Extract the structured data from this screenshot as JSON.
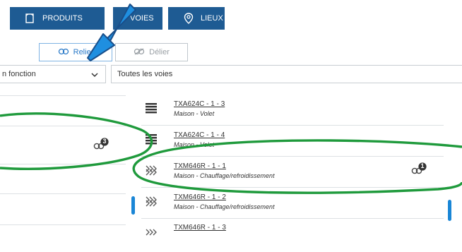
{
  "tabs": [
    {
      "label": "PRODUITS",
      "icon": "box-icon"
    },
    {
      "label": "VOIES",
      "icon": ""
    },
    {
      "label": "LIEUX",
      "icon": "location-pin-icon"
    }
  ],
  "actions": {
    "relier_label": "Relier",
    "delier_label": "Délier"
  },
  "filters": {
    "left_select": "n fonction",
    "right_select": "Toutes les voies"
  },
  "left_list": {
    "badge_count": "3"
  },
  "right_list": [
    {
      "code": "TXA624C - 1 - 3",
      "subtitle": "Maison - Volet",
      "icon": "shutter-icon"
    },
    {
      "code": "TXA624C - 1 - 4",
      "subtitle": "Maison - Volet",
      "icon": "shutter-icon"
    },
    {
      "code": "TXM646R - 1 - 1",
      "subtitle": "Maison - Chauffage/refroidissement",
      "icon": "heating-icon",
      "badge": "1"
    },
    {
      "code": "TXM646R - 1 - 2",
      "subtitle": "Maison - Chauffage/refroidissement",
      "icon": "heating-icon"
    },
    {
      "code": "TXM646R - 1 - 3",
      "subtitle": "",
      "icon": "heating-icon"
    }
  ],
  "colors": {
    "tab_bg": "#1e5b93",
    "accent": "#1a86d6",
    "highlight_ellipse": "#1f9a3c"
  }
}
